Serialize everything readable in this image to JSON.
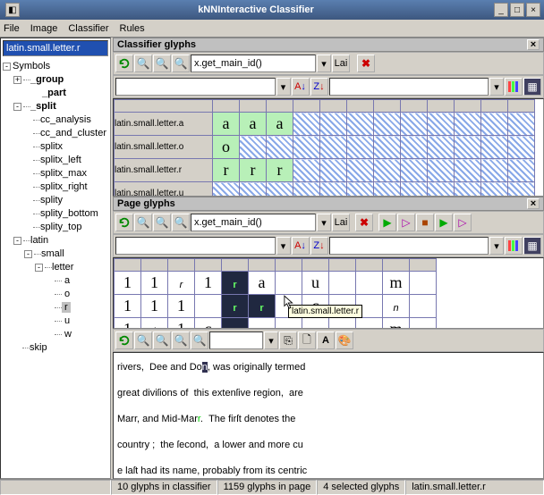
{
  "window": {
    "title": "kNNInteractive Classifier"
  },
  "menu": {
    "file": "File",
    "image": "Image",
    "classifier": "Classifier",
    "rules": "Rules"
  },
  "sidebar": {
    "path": "latin.small.letter.r",
    "symbols": "Symbols",
    "group": "_group",
    "part": "_part",
    "split": "_split",
    "split_items": [
      "cc_analysis",
      "cc_and_cluster",
      "splitx",
      "splitx_left",
      "splitx_max",
      "splitx_right",
      "splity",
      "splity_bottom",
      "splity_top"
    ],
    "latin": "latin",
    "small": "small",
    "letter": "letter",
    "letters": [
      "a",
      "o",
      "r",
      "u",
      "w"
    ],
    "skip": "skip"
  },
  "panel1": {
    "title": "Classifier glyphs",
    "expr": "x.get_main_id()",
    "lai": "Lai",
    "rows": [
      "latin.small.letter.a",
      "latin.small.letter.o",
      "latin.small.letter.r",
      "latin.small.letter.u"
    ],
    "row_glyphs": [
      [
        "a",
        "a",
        "a"
      ],
      [
        "o"
      ],
      [
        "r",
        "r",
        "r"
      ],
      []
    ]
  },
  "panel2": {
    "title": "Page glyphs",
    "expr": "x.get_main_id()",
    "lai": "Lai",
    "tooltip": "latin.small.letter.r"
  },
  "status": {
    "s1": "10 glyphs in classifier",
    "s2": "1159 glyphs in page",
    "s3": "4 selected glyphs",
    "s4": "latin.small.letter.r"
  },
  "doc": {
    "l1a": " rivers,&nbsp;&nbsp;Dee and Do",
    "l1b": "n",
    "l1c": ",&nbsp;was originally termed",
    "l2": "great divi&#383;ions of&nbsp; this exten&#383;ive region,&nbsp; are",
    "l3a": "Marr, and Mid-Mar",
    "l3b": "r",
    "l3c": ".&nbsp;&nbsp;The fir&#383;t denotes the",
    "l4": "country ;&nbsp; the &#383;econd,&nbsp;&nbsp;a lower and more cu",
    "l5": "e la&#383;t had its name, probably from its centric"
  }
}
